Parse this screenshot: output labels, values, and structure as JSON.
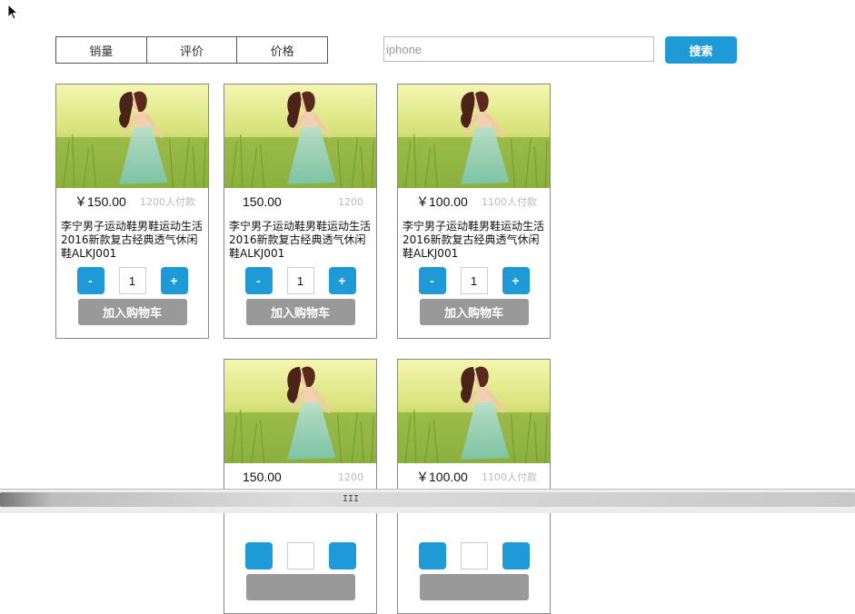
{
  "sort_tabs": [
    "销量",
    "评价",
    "价格"
  ],
  "search": {
    "value": "iphone",
    "placeholder": "iphone",
    "button_label": "搜索"
  },
  "products": [
    {
      "price": "￥150.00",
      "sales": "1200人付款",
      "title": "李宁男子运动鞋男鞋运动生活2016新款复古经典透气休闲鞋ALKJ001",
      "qty": "1",
      "minus": "-",
      "plus": "+",
      "cart": "加入购物车"
    },
    {
      "price": "150.00",
      "sales": "1200",
      "title": "李宁男子运动鞋男鞋运动生活2016新款复古经典透气休闲鞋ALKJ001",
      "qty": "1",
      "minus": "-",
      "plus": "+",
      "cart": "加入购物车"
    },
    {
      "price": "￥100.00",
      "sales": "1100人付款",
      "title": "李宁男子运动鞋男鞋运动生活2016新款复古经典透气休闲鞋ALKJ001",
      "qty": "1",
      "minus": "-",
      "plus": "+",
      "cart": "加入购物车"
    },
    {
      "price": "150.00",
      "sales": "1200",
      "title": "",
      "qty": "",
      "minus": "",
      "plus": "",
      "cart": ""
    },
    {
      "price": "￥100.00",
      "sales": "1100人付款",
      "title": "",
      "qty": "",
      "minus": "",
      "plus": "",
      "cart": ""
    }
  ],
  "scrollbar": {
    "grip": "III"
  },
  "colors": {
    "accent": "#1e9ad6",
    "cart_button": "#999999",
    "muted_text": "#bbbbbb"
  }
}
